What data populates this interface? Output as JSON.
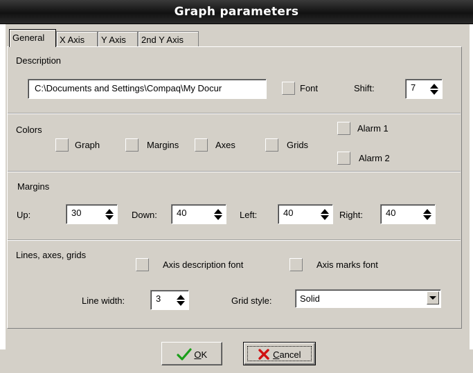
{
  "window": {
    "title": "Graph parameters"
  },
  "tabs": [
    {
      "label": "General",
      "active": true
    },
    {
      "label": "X Axis"
    },
    {
      "label": "Y Axis"
    },
    {
      "label": "2nd Y Axis"
    }
  ],
  "description": {
    "heading": "Description",
    "path_value": "C:\\Documents and Settings\\Compaq\\My Docur",
    "font_label": "Font",
    "shift_label": "Shift:",
    "shift_value": "7"
  },
  "colors": {
    "heading": "Colors",
    "graph": "Graph",
    "margins": "Margins",
    "axes": "Axes",
    "grids": "Grids",
    "alarm1": "Alarm 1",
    "alarm2": "Alarm 2"
  },
  "margins": {
    "heading": "Margins",
    "up_label": "Up:",
    "up_value": "30",
    "down_label": "Down:",
    "down_value": "40",
    "left_label": "Left:",
    "left_value": "40",
    "right_label": "Right:",
    "right_value": "40"
  },
  "lines": {
    "heading": "Lines, axes, grids",
    "axis_desc_font": "Axis description font",
    "axis_marks_font": "Axis marks font",
    "line_width_label": "Line width:",
    "line_width_value": "3",
    "grid_style_label": "Grid style:",
    "grid_style_value": "Solid"
  },
  "buttons": {
    "ok_prefix": "",
    "ok_accel": "O",
    "ok_rest": "K",
    "cancel_accel": "C",
    "cancel_rest": "ancel"
  },
  "accent_colors": {
    "ok_check": "#1a9e1a",
    "cancel_x": "#d01010",
    "titlebar": "#1a1a1a"
  }
}
